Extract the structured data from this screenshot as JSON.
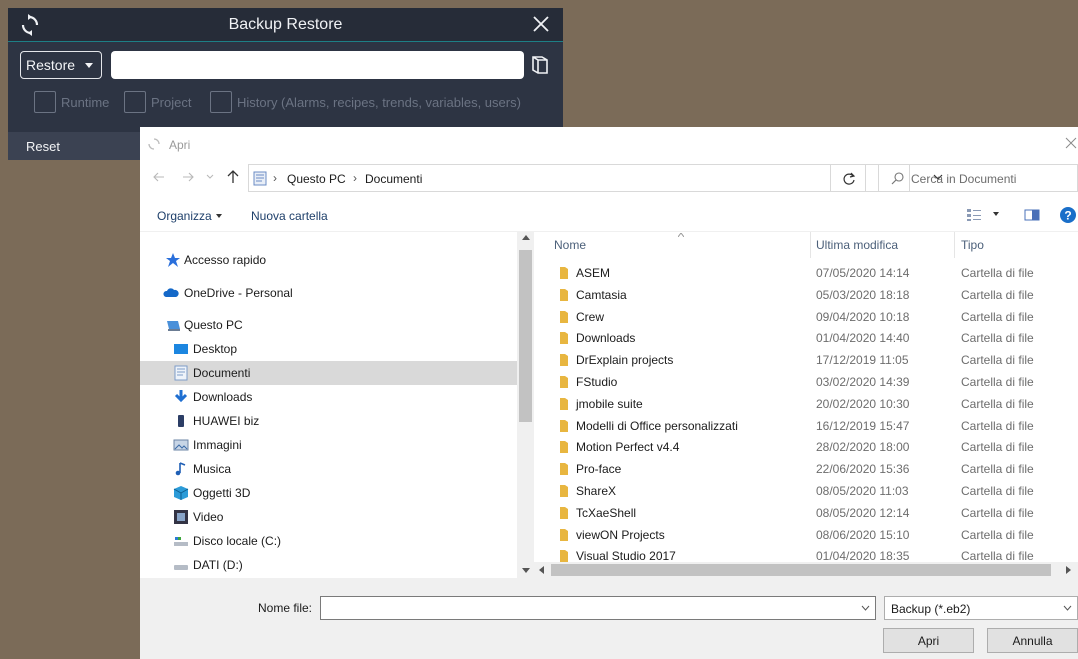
{
  "backup_panel": {
    "title": "Backup Restore",
    "mode_selected": "Restore",
    "path_value": "",
    "checkboxes": [
      {
        "label": "Runtime",
        "checked": false
      },
      {
        "label": "Project",
        "checked": false
      },
      {
        "label": "History (Alarms, recipes, trends, variables, users)",
        "checked": false
      }
    ],
    "reset_label": "Reset"
  },
  "dialog": {
    "title": "Apri",
    "breadcrumb": [
      "Questo PC",
      "Documenti"
    ],
    "search_placeholder": "Cerca in Documenti",
    "organize_label": "Organizza",
    "new_folder_label": "Nuova cartella",
    "nav_tree": [
      {
        "label": "Accesso rapido",
        "icon": "star-icon"
      },
      {
        "label": "OneDrive - Personal",
        "icon": "cloud-icon"
      },
      {
        "label": "Questo PC",
        "icon": "computer-icon"
      },
      {
        "label": "Desktop",
        "icon": "desktop-icon"
      },
      {
        "label": "Documenti",
        "icon": "document-icon",
        "selected": true
      },
      {
        "label": "Downloads",
        "icon": "download-icon"
      },
      {
        "label": "HUAWEI biz",
        "icon": "phone-icon"
      },
      {
        "label": "Immagini",
        "icon": "image-icon"
      },
      {
        "label": "Musica",
        "icon": "music-icon"
      },
      {
        "label": "Oggetti 3D",
        "icon": "cube-icon"
      },
      {
        "label": "Video",
        "icon": "video-icon"
      },
      {
        "label": "Disco locale (C:)",
        "icon": "disk-icon"
      },
      {
        "label": "DATI (D:)",
        "icon": "drive-icon"
      }
    ],
    "columns": {
      "name": "Nome",
      "modified": "Ultima modifica",
      "type": "Tipo"
    },
    "files": [
      {
        "name": "ASEM",
        "modified": "07/05/2020 14:14",
        "type": "Cartella di file"
      },
      {
        "name": "Camtasia",
        "modified": "05/03/2020 18:18",
        "type": "Cartella di file"
      },
      {
        "name": "Crew",
        "modified": "09/04/2020 10:18",
        "type": "Cartella di file"
      },
      {
        "name": "Downloads",
        "modified": "01/04/2020 14:40",
        "type": "Cartella di file"
      },
      {
        "name": "DrExplain projects",
        "modified": "17/12/2019 11:05",
        "type": "Cartella di file"
      },
      {
        "name": "FStudio",
        "modified": "03/02/2020 14:39",
        "type": "Cartella di file"
      },
      {
        "name": "jmobile suite",
        "modified": "20/02/2020 10:30",
        "type": "Cartella di file"
      },
      {
        "name": "Modelli di Office personalizzati",
        "modified": "16/12/2019 15:47",
        "type": "Cartella di file"
      },
      {
        "name": "Motion Perfect v4.4",
        "modified": "28/02/2020 18:00",
        "type": "Cartella di file"
      },
      {
        "name": "Pro-face",
        "modified": "22/06/2020 15:36",
        "type": "Cartella di file"
      },
      {
        "name": "ShareX",
        "modified": "08/05/2020 11:03",
        "type": "Cartella di file"
      },
      {
        "name": "TcXaeShell",
        "modified": "08/05/2020 12:14",
        "type": "Cartella di file"
      },
      {
        "name": "viewON Projects",
        "modified": "08/06/2020 15:10",
        "type": "Cartella di file"
      },
      {
        "name": "Visual Studio 2017",
        "modified": "01/04/2020 18:35",
        "type": "Cartella di file"
      }
    ],
    "filename_label": "Nome file:",
    "filename_value": "",
    "filetype_selected": "Backup (*.eb2)",
    "open_button": "Apri",
    "cancel_button": "Annulla"
  },
  "colors": {
    "panel_bg": "#2d3443",
    "accent": "#1d7f86",
    "folder": "#e8b640",
    "desktop_bg": "#7b6b58"
  }
}
